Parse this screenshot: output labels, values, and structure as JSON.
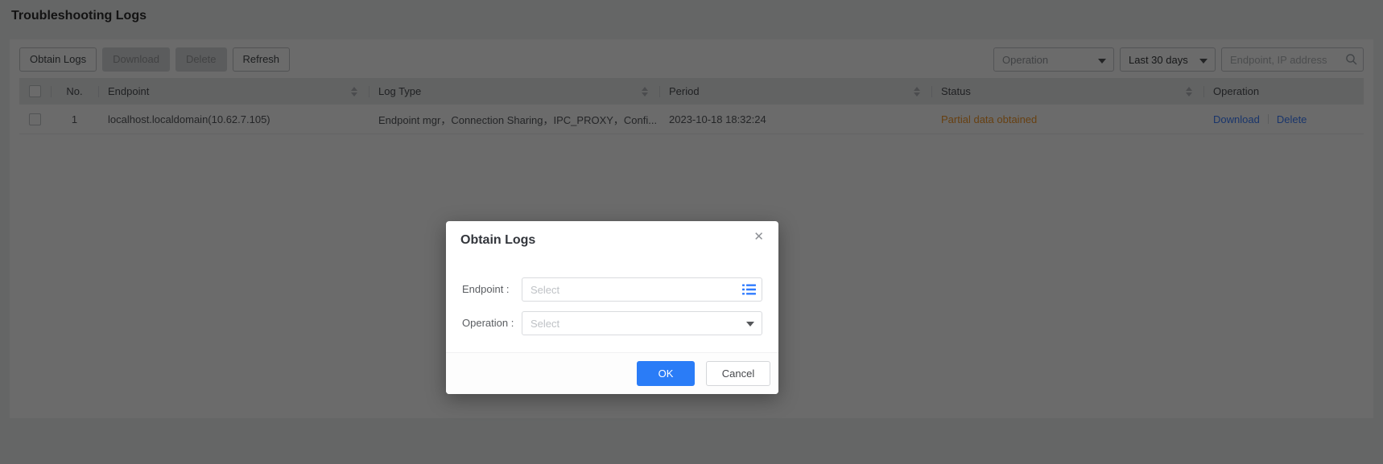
{
  "page": {
    "title": "Troubleshooting Logs"
  },
  "toolbar": {
    "obtain_logs_label": "Obtain Logs",
    "download_label": "Download",
    "delete_label": "Delete",
    "refresh_label": "Refresh",
    "operation_filter_placeholder": "Operation",
    "time_filter_value": "Last 30 days",
    "search_placeholder": "Endpoint, IP address"
  },
  "table": {
    "columns": {
      "no": "No.",
      "endpoint": "Endpoint",
      "log_type": "Log Type",
      "period": "Period",
      "status": "Status",
      "operation": "Operation"
    },
    "rows": [
      {
        "no": "1",
        "endpoint": "localhost.localdomain(10.62.7.105)",
        "log_type": "Endpoint mgr，Connection Sharing，IPC_PROXY，Confi...",
        "period": "2023-10-18 18:32:24",
        "status": "Partial data obtained",
        "operations": {
          "download": "Download",
          "delete": "Delete"
        }
      }
    ]
  },
  "modal": {
    "title": "Obtain Logs",
    "close_glyph": "✕",
    "endpoint_label": "Endpoint :",
    "endpoint_placeholder": "Select",
    "operation_label": "Operation :",
    "operation_placeholder": "Select",
    "ok_label": "OK",
    "cancel_label": "Cancel"
  },
  "colors": {
    "accent_blue": "#2a7cf7",
    "link_blue": "#3d7fff",
    "list_icon_blue": "#2f7bff",
    "status_warning_orange": "#f59a2b",
    "overlay": "rgba(0,0,0,0.58)"
  }
}
